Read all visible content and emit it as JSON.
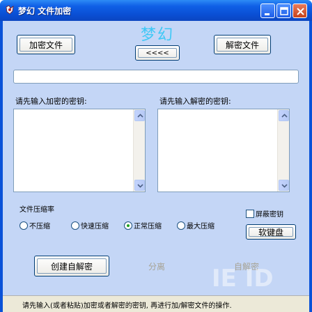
{
  "window": {
    "title": "梦幻 文件加密",
    "icon": "app-icon",
    "controls": [
      "minimize-icon",
      "maximize-icon",
      "close-icon"
    ]
  },
  "toolbar": {
    "encrypt_label": "加密文件",
    "logo_text": "梦幻",
    "arrow_label": "<<<<",
    "decrypt_label": "解密文件"
  },
  "file_path": {
    "value": ""
  },
  "keys": {
    "encrypt_label": "请先输入加密的密钥:",
    "encrypt_value": "",
    "decrypt_label": "请先输入解密的密钥:",
    "decrypt_value": ""
  },
  "compression": {
    "label": "文件压缩率",
    "options": [
      "不压缩",
      "快速压缩",
      "正常压缩",
      "最大压缩"
    ],
    "selected": "正常压缩"
  },
  "options": {
    "hide_key_label": "屏蔽密钥",
    "hide_key_checked": false,
    "keyboard_label": "软键盘"
  },
  "actions": {
    "create_sfx_label": "创建自解密",
    "separate_label": "分离",
    "self_decrypt_label": "自解密"
  },
  "watermark": "IE ID",
  "status": {
    "text": "请先输入(或者粘贴)加密或者解密的密钥, 再进行加/解密文件的操作."
  },
  "colors": {
    "titlebar": "#0a52d8",
    "client_bg": "#c4d6f6",
    "logo": "#3ec8f6",
    "radio_selected": "#21a121"
  }
}
